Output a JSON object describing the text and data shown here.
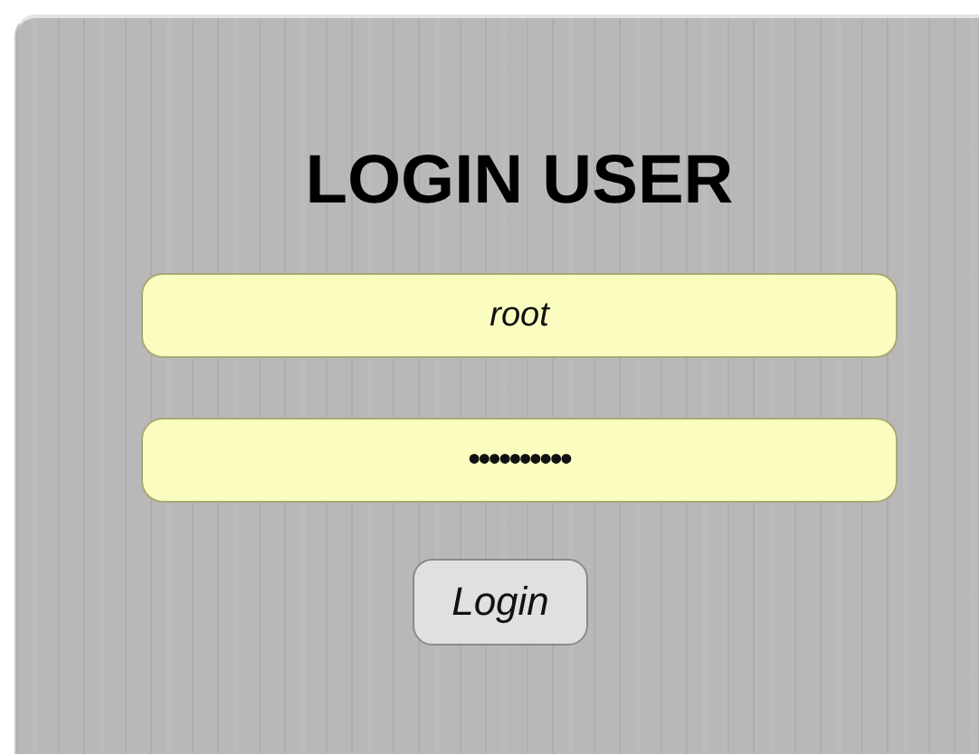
{
  "title": "LOGIN USER",
  "fields": [
    {
      "kind": "username",
      "value": "root"
    },
    {
      "kind": "password",
      "value": "••••••••••"
    }
  ],
  "button": "Login"
}
